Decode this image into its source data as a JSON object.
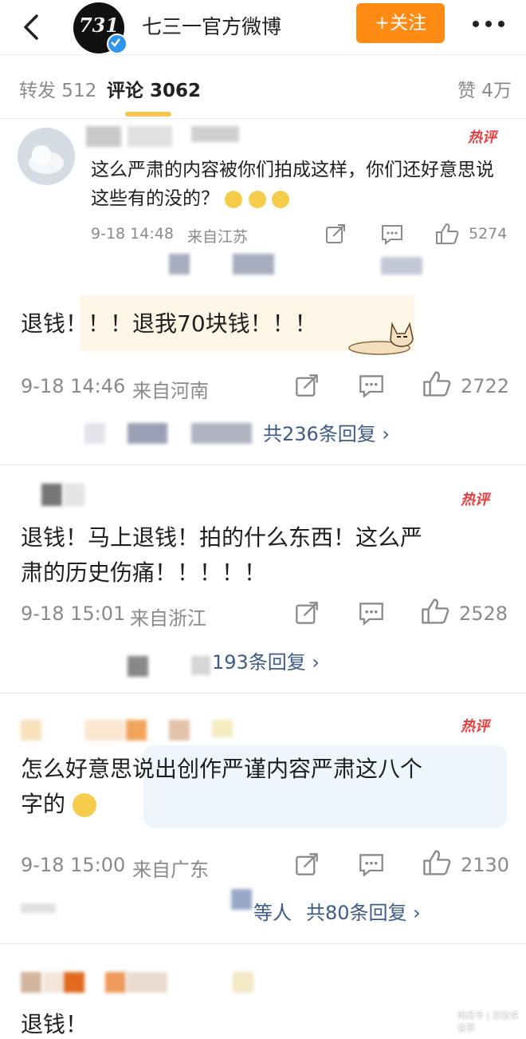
{
  "header": {
    "account_name": "七三一官方微博",
    "logo_text": "731",
    "follow_label": "+关注"
  },
  "tabs": {
    "repost": "转发 512",
    "comments": "评论 3062",
    "likes": "赞 4万"
  },
  "hot_label": "热评",
  "comments": [
    {
      "text": "这么严肃的内容被你们拍成这样，你们还好意思说这些有的没的？",
      "time": "9-18 14:48",
      "location": "来自江苏",
      "likes": "5274"
    },
    {
      "text": "退钱！！！退我70块钱！！！",
      "time": "9-18 14:46",
      "location": "来自河南",
      "likes": "2722",
      "replies": "共236条回复 ›"
    },
    {
      "text_line1": "退钱！马上退钱！拍的什么东西！这么严",
      "text_line2": "肃的历史伤痛！！！！！",
      "time": "9-18 15:01",
      "location": "来自浙江",
      "likes": "2528",
      "replies": "193条回复 ›"
    },
    {
      "text_line1": "怎么好意思说出创作严谨内容严肃这八个",
      "text_line2": "字的",
      "time": "9-18 15:00",
      "location": "来自广东",
      "likes": "2130",
      "replies": "共80条回复 ›",
      "replies_prefix": "等人"
    },
    {
      "text": "退钱！"
    }
  ],
  "watermark": "网易号 | 悠悠说音界",
  "colors": {
    "accent": "#ff8a14",
    "hot": "#ea3d3d",
    "link": "#3d5a8a",
    "verified": "#2f95ea"
  }
}
